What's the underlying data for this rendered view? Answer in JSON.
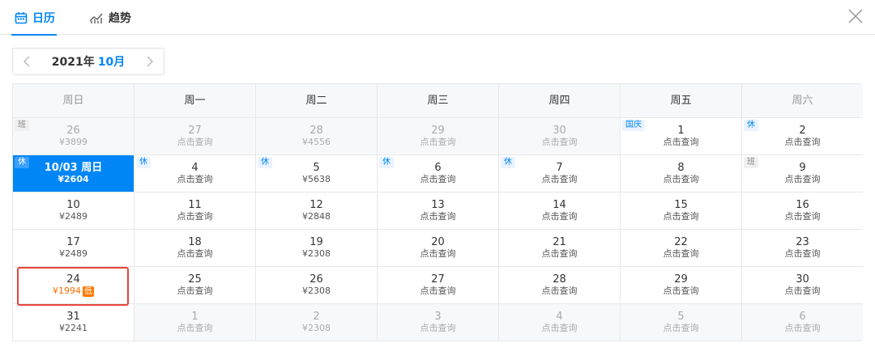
{
  "tabs": {
    "calendar": "日历",
    "trend": "趋势"
  },
  "header": {
    "year": "2021年",
    "month": "10月"
  },
  "weekdays": [
    "周日",
    "周一",
    "周二",
    "周三",
    "周四",
    "周五",
    "周六"
  ],
  "weeks": [
    [
      {
        "day": "26",
        "sub": "¥3899",
        "tag": "班",
        "tag_type": "ban",
        "other": true
      },
      {
        "day": "27",
        "sub": "点击查询",
        "other": true
      },
      {
        "day": "28",
        "sub": "¥4556",
        "other": true
      },
      {
        "day": "29",
        "sub": "点击查询",
        "other": true
      },
      {
        "day": "30",
        "sub": "点击查询",
        "other": true
      },
      {
        "day": "1",
        "sub": "点击查询",
        "tag": "国庆",
        "tag_type": "holiday"
      },
      {
        "day": "2",
        "sub": "点击查询",
        "tag": "休",
        "tag_type": "rest"
      }
    ],
    [
      {
        "day": "10/03 周日",
        "sub": "¥2604",
        "tag": "休",
        "tag_type": "rest",
        "selected": true
      },
      {
        "day": "4",
        "sub": "点击查询",
        "tag": "休",
        "tag_type": "rest"
      },
      {
        "day": "5",
        "sub": "¥5638",
        "tag": "休",
        "tag_type": "rest"
      },
      {
        "day": "6",
        "sub": "点击查询",
        "tag": "休",
        "tag_type": "rest"
      },
      {
        "day": "7",
        "sub": "点击查询",
        "tag": "休",
        "tag_type": "rest"
      },
      {
        "day": "8",
        "sub": "点击查询"
      },
      {
        "day": "9",
        "sub": "点击查询",
        "tag": "班",
        "tag_type": "ban"
      }
    ],
    [
      {
        "day": "10",
        "sub": "¥2489"
      },
      {
        "day": "11",
        "sub": "点击查询"
      },
      {
        "day": "12",
        "sub": "¥2848"
      },
      {
        "day": "13",
        "sub": "点击查询"
      },
      {
        "day": "14",
        "sub": "点击查询"
      },
      {
        "day": "15",
        "sub": "点击查询"
      },
      {
        "day": "16",
        "sub": "点击查询"
      }
    ],
    [
      {
        "day": "17",
        "sub": "¥2489"
      },
      {
        "day": "18",
        "sub": "点击查询"
      },
      {
        "day": "19",
        "sub": "¥2308"
      },
      {
        "day": "20",
        "sub": "点击查询"
      },
      {
        "day": "21",
        "sub": "点击查询"
      },
      {
        "day": "22",
        "sub": "点击查询"
      },
      {
        "day": "23",
        "sub": "点击查询"
      }
    ],
    [
      {
        "day": "24",
        "sub": "¥1994",
        "low": "低",
        "lowest": true
      },
      {
        "day": "25",
        "sub": "点击查询"
      },
      {
        "day": "26",
        "sub": "¥2308"
      },
      {
        "day": "27",
        "sub": "点击查询"
      },
      {
        "day": "28",
        "sub": "点击查询"
      },
      {
        "day": "29",
        "sub": "点击查询"
      },
      {
        "day": "30",
        "sub": "点击查询"
      }
    ],
    [
      {
        "day": "31",
        "sub": "¥2241"
      },
      {
        "day": "1",
        "sub": "点击查询",
        "other": true
      },
      {
        "day": "2",
        "sub": "¥2308",
        "other": true
      },
      {
        "day": "3",
        "sub": "点击查询",
        "other": true
      },
      {
        "day": "4",
        "sub": "点击查询",
        "other": true
      },
      {
        "day": "5",
        "sub": "点击查询",
        "other": true
      },
      {
        "day": "6",
        "sub": "点击查询",
        "other": true
      }
    ]
  ],
  "colors": {
    "accent": "#0086f6",
    "price_low": "#ff6b00",
    "highlight_box": "#e8453c"
  },
  "icons": {
    "calendar_tab": "calendar-icon",
    "trend_tab": "trend-chart-icon",
    "close": "close-icon",
    "prev": "chevron-left-icon",
    "next": "chevron-right-icon"
  }
}
